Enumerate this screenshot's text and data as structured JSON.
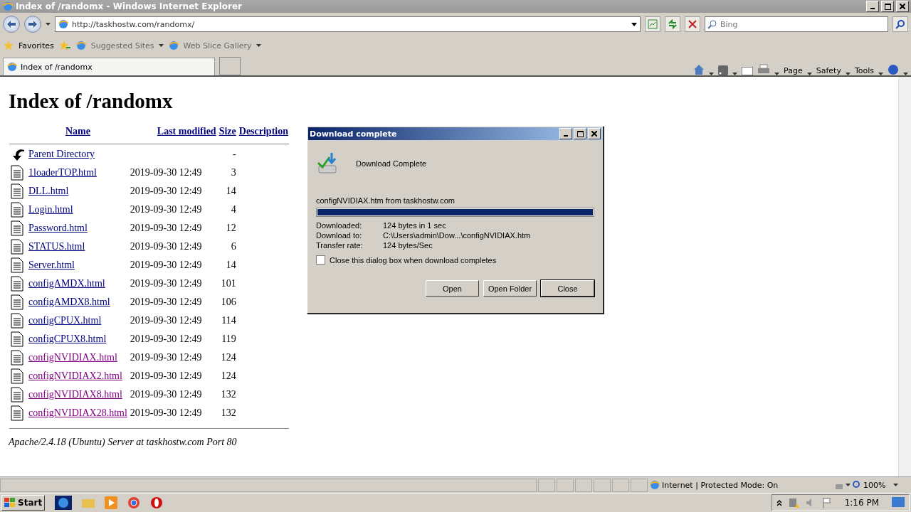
{
  "window": {
    "title": "Index of /randomx - Windows Internet Explorer"
  },
  "address_bar": {
    "url": "http://taskhostw.com/randomx/"
  },
  "search": {
    "placeholder": "Bing"
  },
  "favorites_bar": {
    "favorites": "Favorites",
    "items": [
      "Suggested Sites",
      "Web Slice Gallery"
    ]
  },
  "tabs": [
    {
      "label": "Index of /randomx",
      "selected": true
    }
  ],
  "command_bar": {
    "items": [
      "Page",
      "Safety",
      "Tools"
    ]
  },
  "page": {
    "heading": "Index of /randomx",
    "columns": [
      "Name",
      "Last modified",
      "Size",
      "Description"
    ],
    "rows": [
      {
        "kind": "parent",
        "name": "Parent Directory",
        "modified": "",
        "size": "-",
        "visited": false
      },
      {
        "kind": "file",
        "name": "1loaderTOP.html",
        "modified": "2019-09-30 12:49",
        "size": "3",
        "visited": false
      },
      {
        "kind": "file",
        "name": "DLL.html",
        "modified": "2019-09-30 12:49",
        "size": "14",
        "visited": false
      },
      {
        "kind": "file",
        "name": "Login.html",
        "modified": "2019-09-30 12:49",
        "size": "4",
        "visited": false
      },
      {
        "kind": "file",
        "name": "Password.html",
        "modified": "2019-09-30 12:49",
        "size": "12",
        "visited": false
      },
      {
        "kind": "file",
        "name": "STATUS.html",
        "modified": "2019-09-30 12:49",
        "size": "6",
        "visited": false
      },
      {
        "kind": "file",
        "name": "Server.html",
        "modified": "2019-09-30 12:49",
        "size": "14",
        "visited": false
      },
      {
        "kind": "file",
        "name": "configAMDX.html",
        "modified": "2019-09-30 12:49",
        "size": "101",
        "visited": false
      },
      {
        "kind": "file",
        "name": "configAMDX8.html",
        "modified": "2019-09-30 12:49",
        "size": "106",
        "visited": false
      },
      {
        "kind": "file",
        "name": "configCPUX.html",
        "modified": "2019-09-30 12:49",
        "size": "114",
        "visited": false
      },
      {
        "kind": "file",
        "name": "configCPUX8.html",
        "modified": "2019-09-30 12:49",
        "size": "119",
        "visited": false
      },
      {
        "kind": "file",
        "name": "configNVIDIAX.html",
        "modified": "2019-09-30 12:49",
        "size": "124",
        "visited": true
      },
      {
        "kind": "file",
        "name": "configNVIDIAX2.html",
        "modified": "2019-09-30 12:49",
        "size": "124",
        "visited": true
      },
      {
        "kind": "file",
        "name": "configNVIDIAX8.html",
        "modified": "2019-09-30 12:49",
        "size": "132",
        "visited": true
      },
      {
        "kind": "file",
        "name": "configNVIDIAX28.html",
        "modified": "2019-09-30 12:49",
        "size": "132",
        "visited": true
      }
    ],
    "footer": "Apache/2.4.18 (Ubuntu) Server at taskhostw.com Port 80"
  },
  "dialog": {
    "title": "Download complete",
    "heading": "Download Complete",
    "source": "configNVIDIAX.htm from taskhostw.com",
    "progress": {
      "level": 1
    },
    "details": [
      {
        "label": "Downloaded:",
        "value": "124 bytes in 1 sec"
      },
      {
        "label": "Download to:",
        "value": "C:\\Users\\admin\\Dow...\\configNVIDIAX.htm"
      },
      {
        "label": "Transfer rate:",
        "value": "124 bytes/Sec"
      }
    ],
    "close_when_done": {
      "label": "Close this dialog box when download completes",
      "checked": false
    },
    "buttons": [
      "Open",
      "Open Folder",
      "Close"
    ]
  },
  "status_bar": {
    "zone": "Internet | Protected Mode: On",
    "zoom": "100%"
  },
  "taskbar": {
    "start": "Start",
    "time": "1:16 PM"
  }
}
